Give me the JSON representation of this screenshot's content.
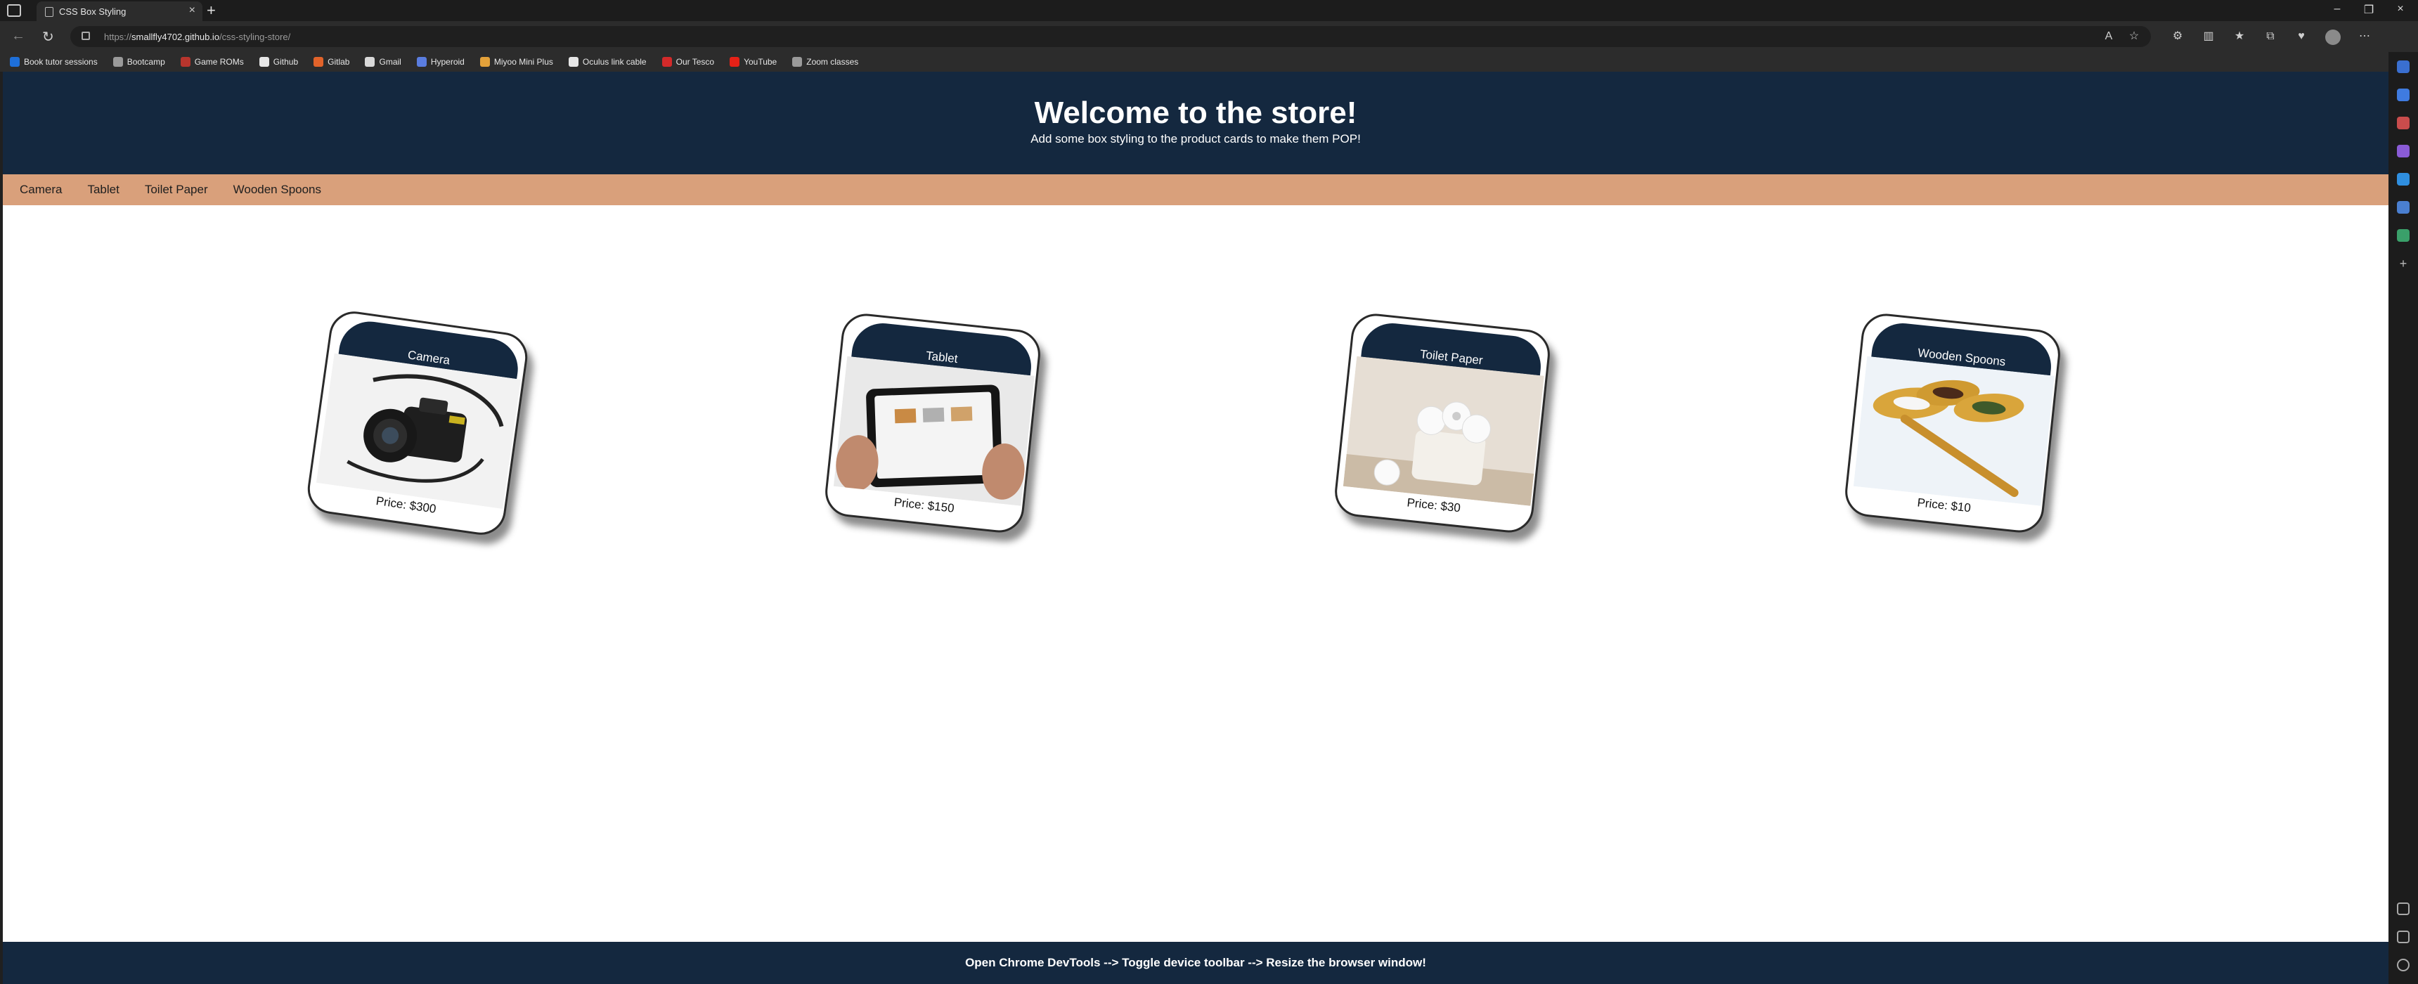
{
  "browser": {
    "tab_title": "CSS Box Styling",
    "url_prefix": "https://",
    "url_host": "smallfly4702.github.io",
    "url_path": "/css-styling-store/",
    "bookmarks": [
      {
        "label": "Book tutor sessions",
        "icon": "calendar-icon",
        "color": "#1e6fd9"
      },
      {
        "label": "Bootcamp",
        "icon": "arrow-icon",
        "color": "#9a9a9a"
      },
      {
        "label": "Game ROMs",
        "icon": "game-icon",
        "color": "#b8352d"
      },
      {
        "label": "Github",
        "icon": "github-icon",
        "color": "#e6e6e6"
      },
      {
        "label": "Gitlab",
        "icon": "gitlab-icon",
        "color": "#e2632a"
      },
      {
        "label": "Gmail",
        "icon": "gmail-icon",
        "color": "#d9d9d9"
      },
      {
        "label": "Hyperoid",
        "icon": "hyperoid-icon",
        "color": "#5a7de0"
      },
      {
        "label": "Miyoo Mini Plus",
        "icon": "folder-icon",
        "color": "#e3a13a"
      },
      {
        "label": "Oculus link cable",
        "icon": "doc-icon",
        "color": "#e6e6e6"
      },
      {
        "label": "Our Tesco",
        "icon": "tesco-icon",
        "color": "#d32a2a"
      },
      {
        "label": "YouTube",
        "icon": "youtube-icon",
        "color": "#e62117"
      },
      {
        "label": "Zoom classes",
        "icon": "arrow-icon",
        "color": "#9a9a9a"
      }
    ]
  },
  "page": {
    "header": {
      "title": "Welcome to the store!",
      "subtitle": "Add some box styling to the product cards to make them POP!"
    },
    "nav": [
      "Camera",
      "Tablet",
      "Toilet Paper",
      "Wooden Spoons"
    ],
    "products": [
      {
        "name": "Camera",
        "price": "Price: $300",
        "image": "camera-photo"
      },
      {
        "name": "Tablet",
        "price": "Price: $150",
        "image": "tablet-photo"
      },
      {
        "name": "Toilet Paper",
        "price": "Price: $30",
        "image": "toilet-paper-photo"
      },
      {
        "name": "Wooden Spoons",
        "price": "Price: $10",
        "image": "wooden-spoons-photo"
      }
    ],
    "footer": "Open Chrome DevTools --> Toggle device toolbar --> Resize the browser window!"
  },
  "colors": {
    "header_bg": "#14283f",
    "nav_bg": "#d9a07b",
    "page_bg": "#ffffff"
  }
}
